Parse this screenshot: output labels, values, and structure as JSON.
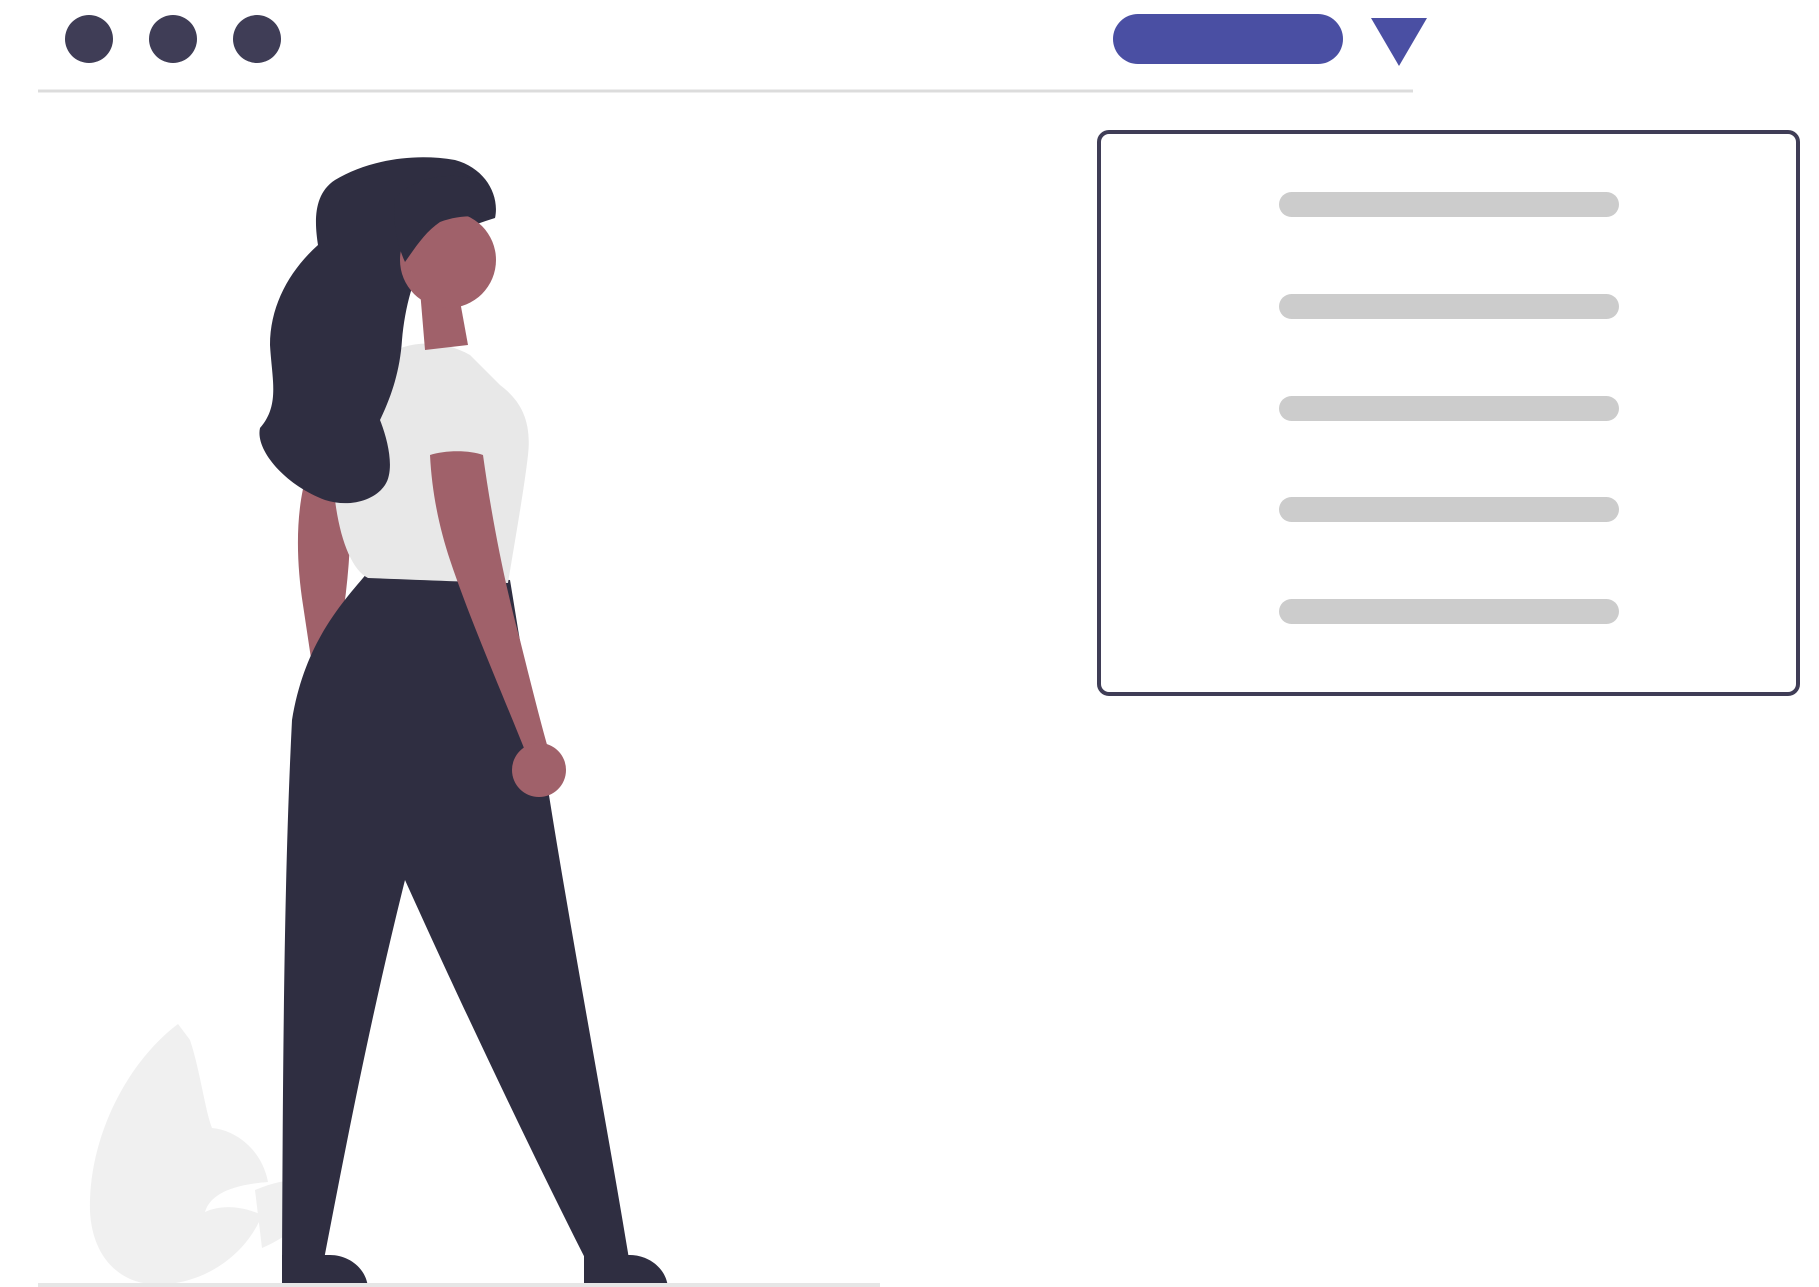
{
  "colors": {
    "background": "#ffffff",
    "window_dot": "#3f3d56",
    "accent": "#4a4fa3",
    "header_rule": "#dcdcdc",
    "panel_border": "#3f3d56",
    "placeholder_line": "#cccccc",
    "skin": "#a0616a",
    "hair": "#2f2e41",
    "pants": "#2f2e41",
    "shirt": "#e8e8e8",
    "leaf": "#f0f0f0",
    "ground": "#e6e6e6"
  },
  "header": {
    "window_controls": [
      "dot",
      "dot",
      "dot"
    ],
    "menu_icon": "triangle-down-icon"
  },
  "panel": {
    "placeholder_line_count": 5
  },
  "illustration": {
    "figure": "standing-woman",
    "plant": "leaf"
  }
}
